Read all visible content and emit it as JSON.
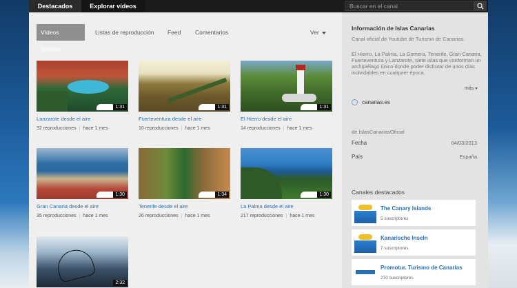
{
  "topbar": {
    "tabs": [
      {
        "label": "Destacados",
        "active": true
      },
      {
        "label": "Explorar vídeos",
        "active": false
      }
    ],
    "search_placeholder": "Buscar en el canal",
    "icon": "search-icon"
  },
  "subtabs": [
    {
      "label": "Vídeos subidos",
      "active": true
    },
    {
      "label": "Listas de reproducción",
      "active": false
    },
    {
      "label": "Feed",
      "active": false
    },
    {
      "label": "Comentarios",
      "active": false
    }
  ],
  "view_menu": {
    "label": "Ver"
  },
  "videos": [
    {
      "title": "Lanzarote desde el aire",
      "views": "32 reproducciones",
      "age": "hace 1 mes",
      "duration": "1:31"
    },
    {
      "title": "Fuerteventura desde el aire",
      "views": "10 reproducciones",
      "age": "hace 1 mes",
      "duration": "1:31"
    },
    {
      "title": "El Hierro desde el aire",
      "views": "14 reproducciones",
      "age": "hace 1 mes",
      "duration": "1:31"
    },
    {
      "title": "Gran Canaria desde el aire",
      "views": "35 reproducciones",
      "age": "hace 1 mes",
      "duration": "1:30"
    },
    {
      "title": "Tenerife desde el aire",
      "views": "26 reproducciones",
      "age": "hace 1 mes",
      "duration": "1:34"
    },
    {
      "title": "La Palma desde el aire",
      "views": "217 reproducciones",
      "age": "hace 1 mes",
      "duration": "1:30"
    },
    {
      "title": "",
      "views": "",
      "age": "",
      "duration": "2:32"
    }
  ],
  "sidebar": {
    "title": "Información de Islas Canarias",
    "description": "Canal oficial de Youtube de Turismo de Canarias.",
    "description2": "El Hierro, La Palma, La Gomera, Tenerife, Gran Canaria, Fuerteventura y Lanzarote, siete islas que conforman un archipiélago único donde poder disfrutar de unos días inolvidables en cualquier época.",
    "more": "más",
    "link": "canarias.es",
    "handle": "de IslasCanariasOficial",
    "fields": [
      {
        "key": "Fecha",
        "value": "04/03/2013"
      },
      {
        "key": "País",
        "value": "España"
      }
    ],
    "featured_title": "Canales destacados",
    "channels": [
      {
        "name": "The Canary Islands",
        "subs": "5 suscriptores"
      },
      {
        "name": "Kanarische Inseln",
        "subs": "7 suscriptores"
      },
      {
        "name": "Promotur. Turismo de Canarias",
        "subs": "270 suscriptores"
      }
    ]
  }
}
